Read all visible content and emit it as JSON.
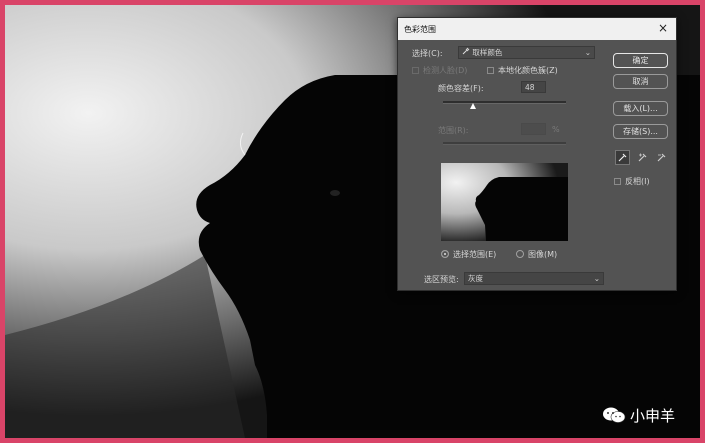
{
  "dialog": {
    "title": "色彩范围",
    "close_glyph": "×",
    "select_label": "选择(C):",
    "select_value": "取样颜色",
    "detect_faces_label": "检测人脸(D)",
    "localized_clusters_label": "本地化颜色簇(Z)",
    "fuzziness_label": "颜色容差(F):",
    "fuzziness_value": "48",
    "fuzziness_fraction": 0.24,
    "range_label": "范围(R):",
    "range_unit": "%",
    "radio_selection": "选择范围(E)",
    "radio_image": "图像(M)",
    "preview_label": "选区预览:",
    "preview_value": "灰度",
    "buttons": {
      "ok": "确定",
      "cancel": "取消",
      "load": "载入(L)...",
      "save": "存储(S)..."
    },
    "invert_label": "反相(I)"
  },
  "watermark": {
    "text": "小申羊"
  },
  "colors": {
    "border": "#d94468",
    "dialog_bg": "#535353"
  }
}
